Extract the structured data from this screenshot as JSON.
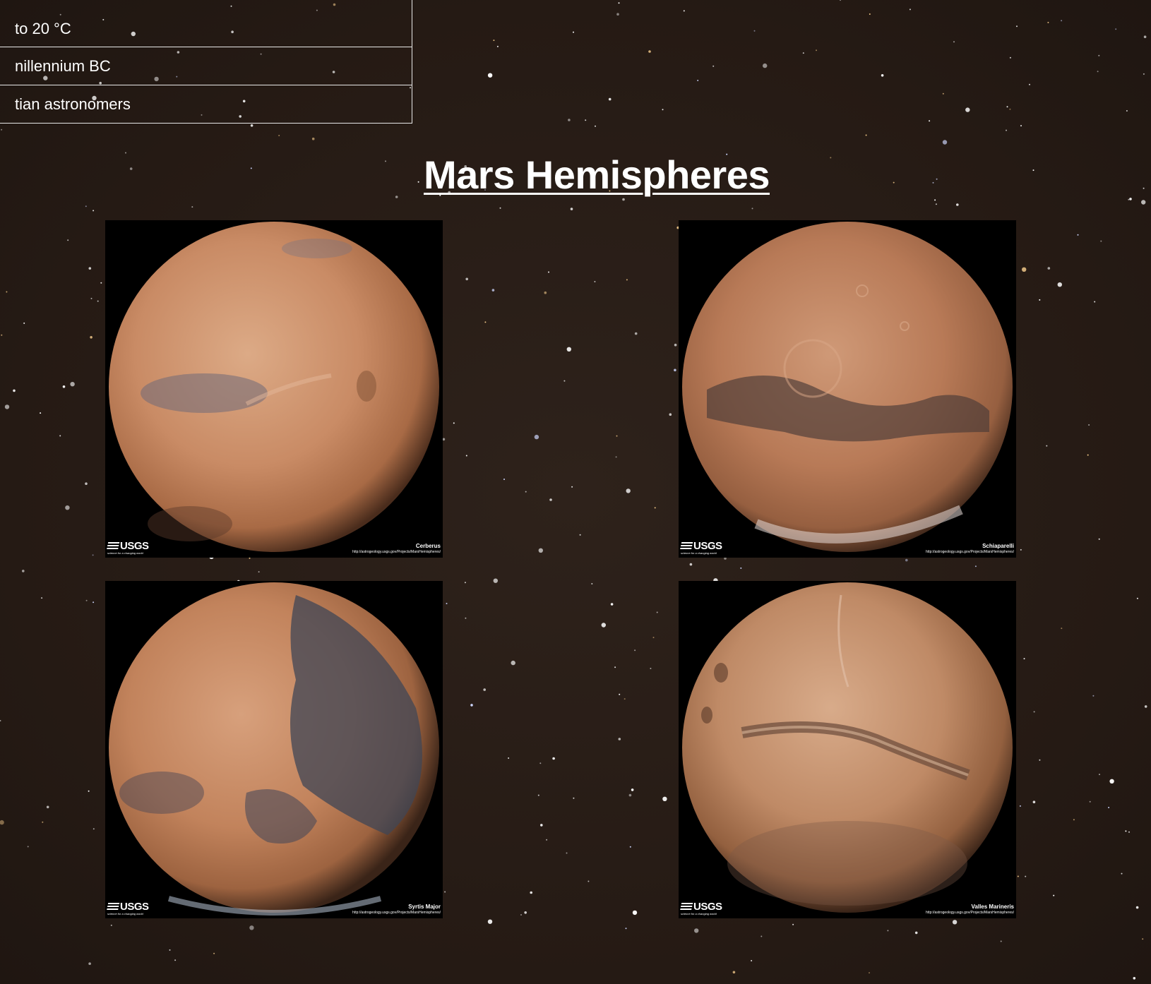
{
  "facts": {
    "rows": [
      {
        "text": "to 20 °C"
      },
      {
        "text": "nillennium BC"
      },
      {
        "text": "tian astronomers"
      }
    ]
  },
  "section": {
    "title": "Mars Hemispheres"
  },
  "hemispheres": [
    {
      "name": "Cerberus",
      "logo": "USGS",
      "logo_tagline": "science for a changing world",
      "url": "http://astrogeology.usgs.gov/Projects/MarsHemispheres/"
    },
    {
      "name": "Schiaparelli",
      "logo": "USGS",
      "logo_tagline": "science for a changing world",
      "url": "http://astrogeology.usgs.gov/Projects/MarsHemispheres/"
    },
    {
      "name": "Syrtis Major",
      "logo": "USGS",
      "logo_tagline": "science for a changing world",
      "url": "http://astrogeology.usgs.gov/Projects/MarsHemispheres/"
    },
    {
      "name": "Valles Marineris",
      "logo": "USGS",
      "logo_tagline": "science for a changing world",
      "url": "http://astrogeology.usgs.gov/Projects/MarsHemispheres/"
    }
  ],
  "colors": {
    "background": "#2b1f18",
    "mars_light": "#d69a74",
    "mars_mid": "#b8754f",
    "mars_dark": "#4a4a5c",
    "text": "#ffffff"
  },
  "icons": {
    "background": "starfield-background",
    "logo": "usgs-logo"
  }
}
